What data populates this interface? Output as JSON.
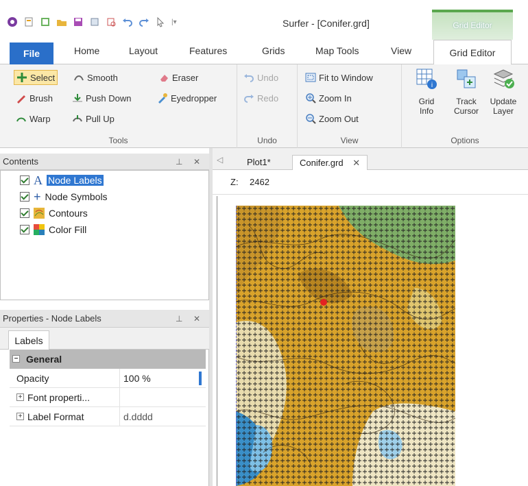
{
  "app": {
    "title": "Surfer - [Conifer.grd]",
    "context_tab_header": "Grid Editor"
  },
  "ribbon": {
    "tabs": [
      "File",
      "Home",
      "Layout",
      "Features",
      "Grids",
      "Map Tools",
      "View",
      "Grid Editor"
    ],
    "active_tab": "Grid Editor",
    "groups": {
      "tools": {
        "label": "Tools",
        "select": "Select",
        "smooth": "Smooth",
        "eraser": "Eraser",
        "brush": "Brush",
        "push_down": "Push Down",
        "eyedropper": "Eyedropper",
        "warp": "Warp",
        "pull_up": "Pull Up"
      },
      "undo": {
        "label": "Undo",
        "undo": "Undo",
        "redo": "Redo"
      },
      "view": {
        "label": "View",
        "fit": "Fit to Window",
        "zoom_in": "Zoom In",
        "zoom_out": "Zoom Out"
      },
      "options": {
        "label": "Options",
        "grid_info_l1": "Grid",
        "grid_info_l2": "Info",
        "track_l1": "Track",
        "track_l2": "Cursor",
        "update_l1": "Update",
        "update_l2": "Layer"
      }
    }
  },
  "contents": {
    "title": "Contents",
    "items": [
      {
        "label": "Node Labels",
        "selected": true,
        "icon": "text-icon"
      },
      {
        "label": "Node Symbols",
        "selected": false,
        "icon": "plus-icon"
      },
      {
        "label": "Contours",
        "selected": false,
        "icon": "contour-map-icon"
      },
      {
        "label": "Color Fill",
        "selected": false,
        "icon": "color-fill-icon"
      }
    ]
  },
  "properties": {
    "title": "Properties - Node Labels",
    "tab": "Labels",
    "section": "General",
    "rows": [
      {
        "key": "Opacity",
        "value": "100 %"
      },
      {
        "key": "Font properti...",
        "value": ""
      },
      {
        "key": "Label Format",
        "value": "d.dddd"
      }
    ]
  },
  "documents": {
    "tabs": [
      "Plot1*",
      "Conifer.grd"
    ],
    "active": "Conifer.grd"
  },
  "zbar": {
    "label": "Z:",
    "value": "2462"
  },
  "colors": {
    "file_tab": "#2a6fc9",
    "selection": "#2f77d1",
    "highlight": "#fbe7a6",
    "context_green": "#5aa74e"
  }
}
